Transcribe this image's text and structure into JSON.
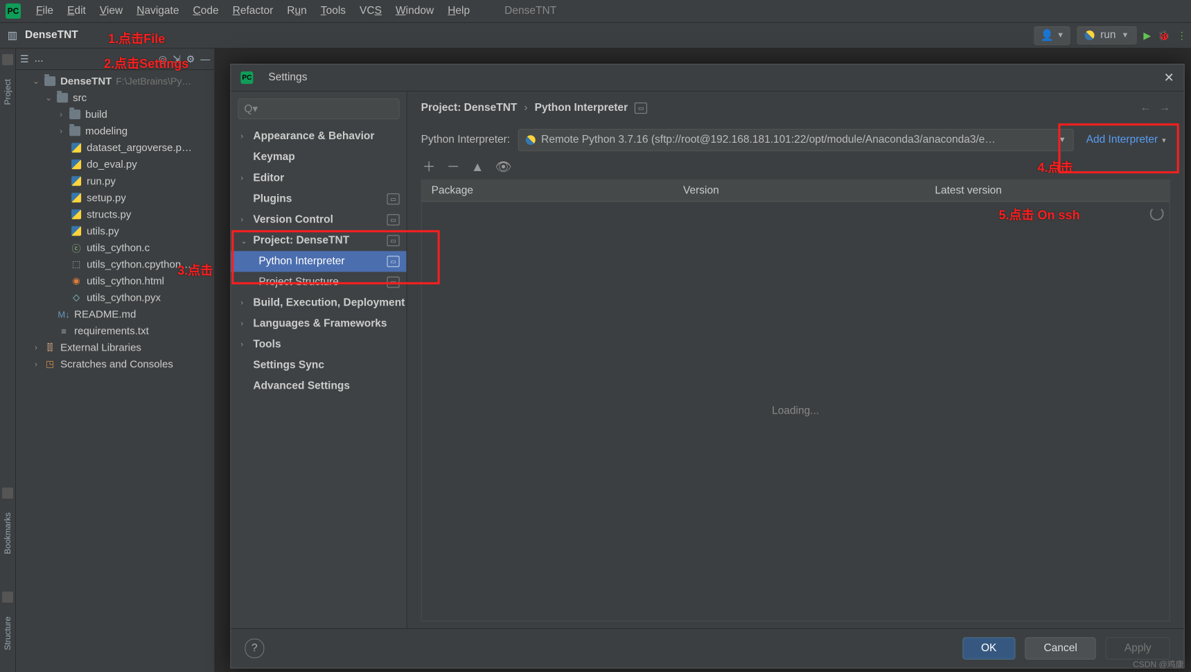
{
  "menubar": {
    "items": [
      "File",
      "Edit",
      "View",
      "Navigate",
      "Code",
      "Refactor",
      "Run",
      "Tools",
      "VCS",
      "Window",
      "Help"
    ],
    "title": "DenseTNT"
  },
  "toolbar": {
    "project": "DenseTNT",
    "run_config": "run"
  },
  "project_tree": {
    "header_label": "...",
    "root": {
      "name": "DenseTNT",
      "path": "F:\\JetBrains\\Py…"
    },
    "src": "src",
    "build": "build",
    "modeling": "modeling",
    "files": [
      "dataset_argoverse.p…",
      "do_eval.py",
      "run.py",
      "setup.py",
      "structs.py",
      "utils.py",
      "utils_cython.c",
      "utils_cython.cpython…",
      "utils_cython.html",
      "utils_cython.pyx"
    ],
    "readme": "README.md",
    "requirements": "requirements.txt",
    "ext_libs": "External Libraries",
    "scratches": "Scratches and Consoles"
  },
  "leftrail": {
    "label_project": "Project",
    "label_bookmarks": "Bookmarks",
    "label_structure": "Structure"
  },
  "settings": {
    "title": "Settings",
    "search_placeholder": "",
    "search_prefix": "Q▾",
    "tree": {
      "appearance": "Appearance & Behavior",
      "keymap": "Keymap",
      "editor": "Editor",
      "plugins": "Plugins",
      "vcs": "Version Control",
      "project": "Project: DenseTNT",
      "py_interp": "Python Interpreter",
      "proj_struct": "Project Structure",
      "build": "Build, Execution, Deployment",
      "lang": "Languages & Frameworks",
      "tools": "Tools",
      "sync": "Settings Sync",
      "adv": "Advanced Settings"
    },
    "breadcrumb": {
      "a": "Project: DenseTNT",
      "b": "Python Interpreter"
    },
    "interp_label": "Python Interpreter:",
    "interp_value": "Remote Python 3.7.16 (sftp://root@192.168.181.101:22/opt/module/Anaconda3/anaconda3/e…",
    "add_interp": "Add Interpreter",
    "pkg_cols": {
      "c1": "Package",
      "c2": "Version",
      "c3": "Latest version"
    },
    "loading": "Loading...",
    "buttons": {
      "ok": "OK",
      "cancel": "Cancel",
      "apply": "Apply"
    }
  },
  "annotations": {
    "a1": "1.点击File",
    "a2": "2.点击Settings",
    "a3": "3.点击",
    "a4": "4.点击",
    "a5": "5.点击 On ssh"
  },
  "watermark": "CSDN @鸡康"
}
